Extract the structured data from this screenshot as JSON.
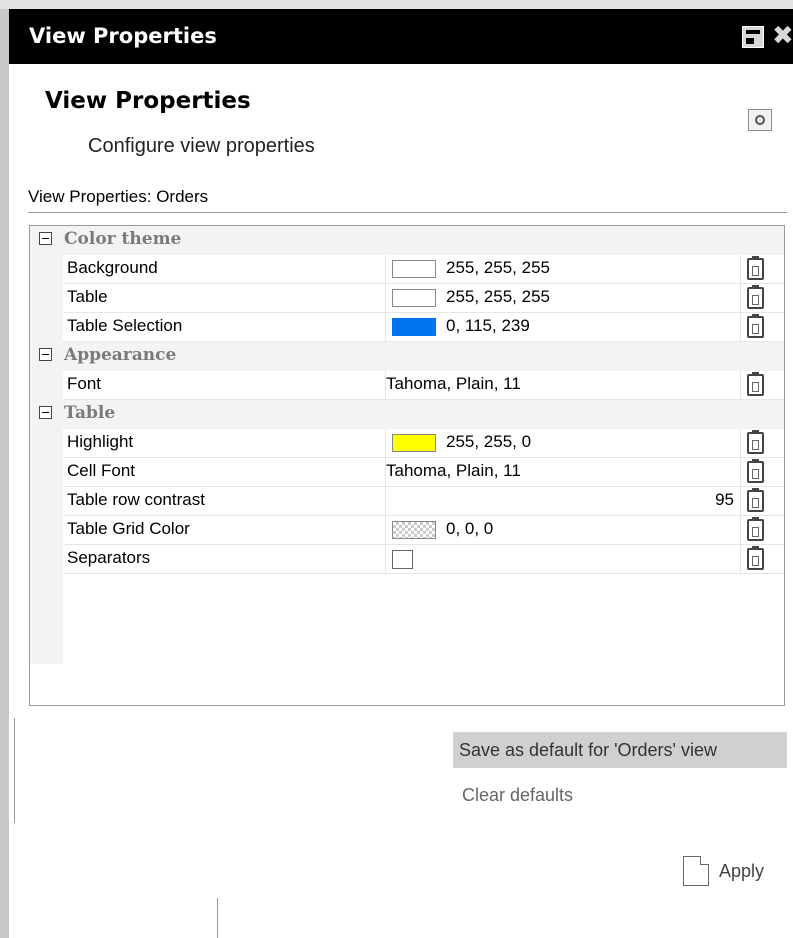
{
  "window": {
    "title": "View Properties",
    "restore_icon": "restore-icon",
    "close_icon": "close-icon"
  },
  "header": {
    "title": "View Properties",
    "subtitle": "Configure view properties",
    "settings_icon": "gear-icon"
  },
  "panel": {
    "label": "View Properties: Orders"
  },
  "grid": {
    "categories": [
      {
        "label": "Color theme"
      },
      {
        "label": "Appearance"
      },
      {
        "label": "Table"
      }
    ],
    "properties": {
      "background": {
        "name": "Background",
        "value": "255, 255, 255",
        "color": "#ffffff"
      },
      "table": {
        "name": "Table",
        "value": "255, 255, 255",
        "color": "#ffffff"
      },
      "table_selection": {
        "name": "Table Selection",
        "value": "0, 115, 239",
        "color": "#0073ef"
      },
      "font": {
        "name": "Font",
        "value": "Tahoma, Plain, 11"
      },
      "highlight": {
        "name": "Highlight",
        "value": "255, 255, 0",
        "color": "#ffff00"
      },
      "cell_font": {
        "name": "Cell Font",
        "value": "Tahoma, Plain, 11"
      },
      "row_contrast": {
        "name": "Table row contrast",
        "value": "95"
      },
      "grid_color": {
        "name": "Table Grid Color",
        "value": "0, 0, 0"
      },
      "separators": {
        "name": "Separators",
        "checked": false
      }
    }
  },
  "actions": {
    "save_default": "Save as default for 'Orders' view",
    "clear_defaults": "Clear defaults",
    "apply": "Apply"
  }
}
